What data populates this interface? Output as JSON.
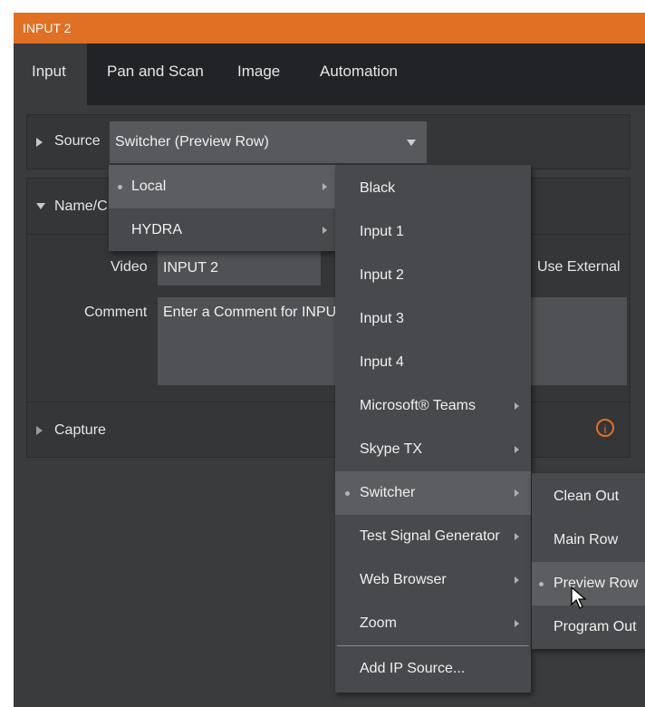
{
  "window": {
    "title": "INPUT 2"
  },
  "tabs": [
    "Input",
    "Pan and Scan",
    "Image",
    "Automation"
  ],
  "source": {
    "label": "Source",
    "value": "Switcher (Preview Row)"
  },
  "name_section": {
    "label_partial": "Name/C",
    "video_label": "Video",
    "video_value": "INPUT 2",
    "use_external_label": "Use External",
    "comment_label": "Comment",
    "comment_placeholder": "Enter a Comment for INPU"
  },
  "capture": {
    "label": "Capture"
  },
  "menu1": {
    "items": [
      "Local",
      "HYDRA"
    ]
  },
  "menu2": {
    "items": [
      "Black",
      "Input 1",
      "Input 2",
      "Input 3",
      "Input 4",
      "Microsoft® Teams",
      "Skype TX",
      "Switcher",
      "Test Signal Generator",
      "Web Browser",
      "Zoom"
    ],
    "footer": "Add IP Source..."
  },
  "menu3": {
    "items": [
      "Clean Out",
      "Main Row",
      "Preview Row",
      "Program Out"
    ]
  },
  "colors": {
    "accent": "#e07023",
    "panel": "#3a3b3d"
  }
}
